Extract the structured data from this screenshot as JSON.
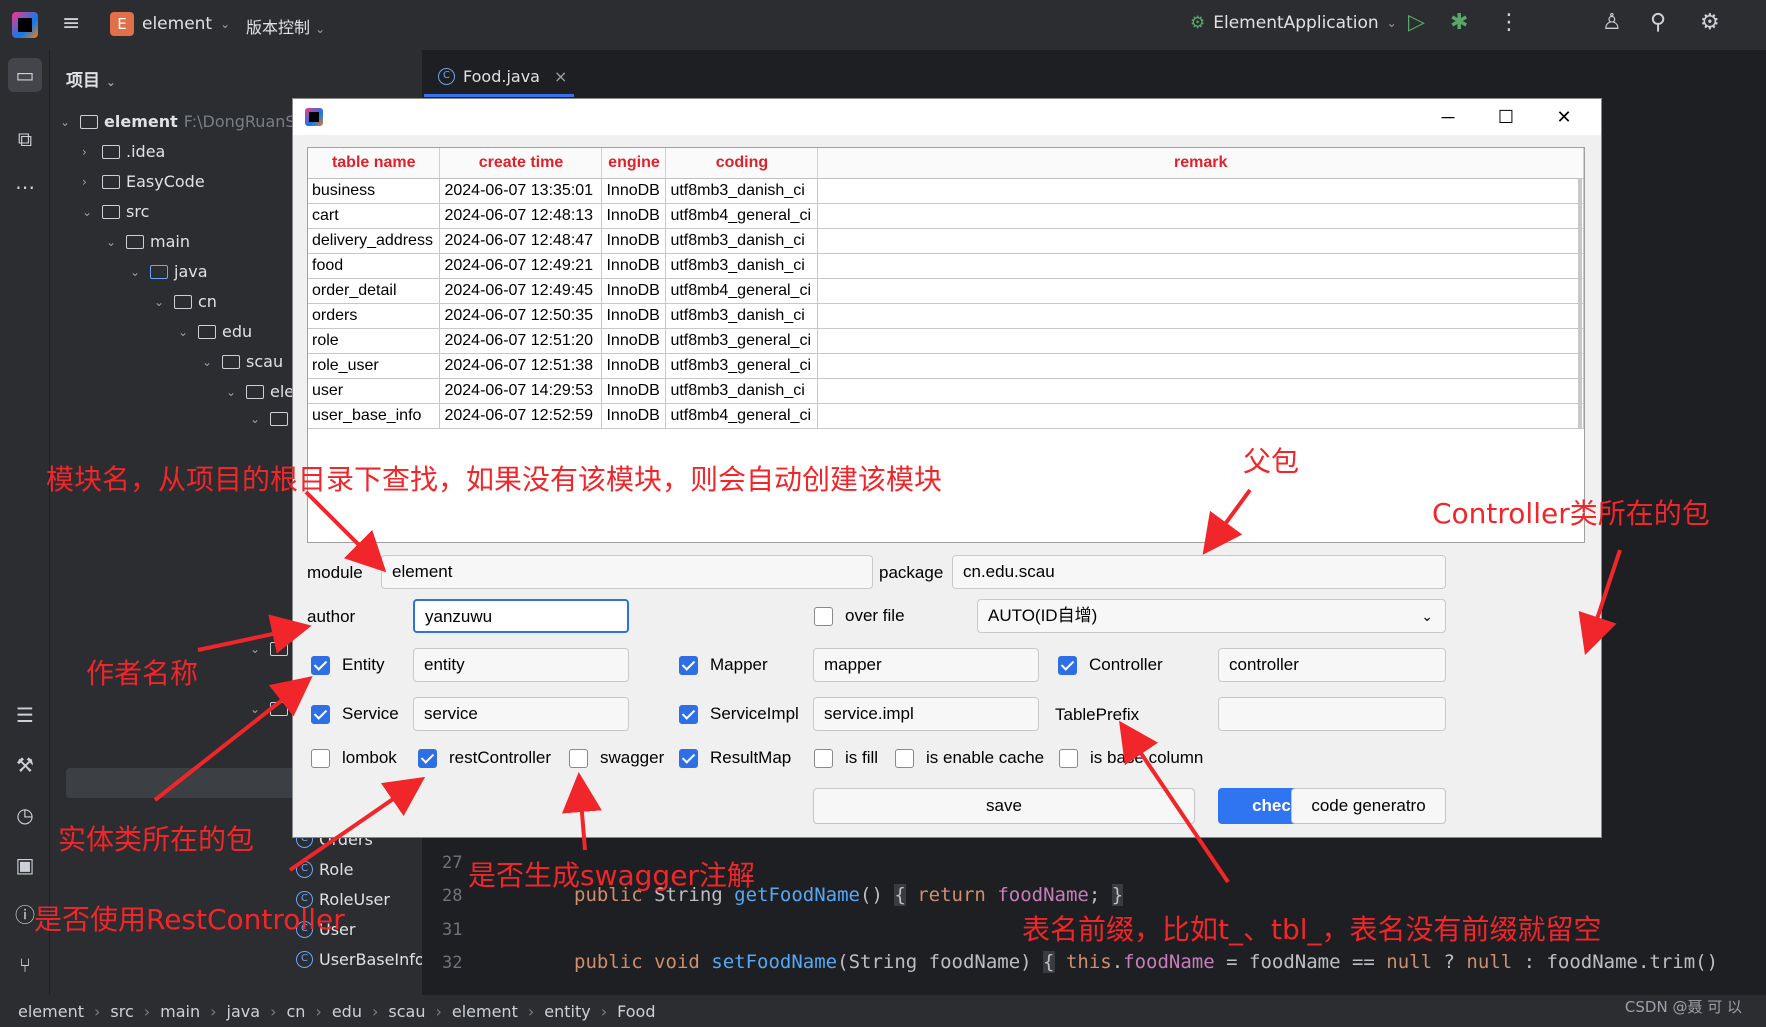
{
  "topbar": {
    "project_badge": "E",
    "project_name": "element",
    "vcs_label": "版本控制",
    "run_config": "ElementApplication"
  },
  "project_panel": {
    "title": "项目",
    "root": {
      "name": "element",
      "path": "F:\\DongRuanS"
    },
    "tree": [
      {
        "label": ".idea"
      },
      {
        "label": "EasyCode"
      },
      {
        "label": "src"
      },
      {
        "label": "main"
      },
      {
        "label": "java"
      },
      {
        "label": "cn"
      },
      {
        "label": "edu"
      },
      {
        "label": "scau"
      },
      {
        "label": "ele"
      }
    ],
    "classes": [
      {
        "label": "Orders"
      },
      {
        "label": "Role"
      },
      {
        "label": "RoleUser"
      },
      {
        "label": "User"
      },
      {
        "label": "UserBaseInfo"
      }
    ]
  },
  "editor": {
    "tab_label": "Food.java",
    "lines": [
      {
        "num": "27",
        "code": ""
      },
      {
        "num": "28",
        "code": "public String getFoodName() { return foodName; }"
      },
      {
        "num": "31",
        "code": ""
      },
      {
        "num": "32",
        "code": "public void setFoodName(String foodName) { this.foodName = foodName == null ? null : foodName.trim()"
      }
    ]
  },
  "dialog": {
    "columns": [
      "table name",
      "create time",
      "engine",
      "coding",
      "remark"
    ],
    "rows": [
      [
        "business",
        "2024-06-07 13:35:01",
        "InnoDB",
        "utf8mb3_danish_ci",
        ""
      ],
      [
        "cart",
        "2024-06-07 12:48:13",
        "InnoDB",
        "utf8mb4_general_ci",
        ""
      ],
      [
        "delivery_address",
        "2024-06-07 12:48:47",
        "InnoDB",
        "utf8mb3_danish_ci",
        ""
      ],
      [
        "food",
        "2024-06-07 12:49:21",
        "InnoDB",
        "utf8mb3_danish_ci",
        ""
      ],
      [
        "order_detail",
        "2024-06-07 12:49:45",
        "InnoDB",
        "utf8mb4_general_ci",
        ""
      ],
      [
        "orders",
        "2024-06-07 12:50:35",
        "InnoDB",
        "utf8mb3_danish_ci",
        ""
      ],
      [
        "role",
        "2024-06-07 12:51:20",
        "InnoDB",
        "utf8mb3_general_ci",
        ""
      ],
      [
        "role_user",
        "2024-06-07 12:51:38",
        "InnoDB",
        "utf8mb3_general_ci",
        ""
      ],
      [
        "user",
        "2024-06-07 14:29:53",
        "InnoDB",
        "utf8mb3_danish_ci",
        ""
      ],
      [
        "user_base_info",
        "2024-06-07 12:52:59",
        "InnoDB",
        "utf8mb4_general_ci",
        ""
      ]
    ],
    "module_label": "module",
    "module_value": "element",
    "package_label": "package",
    "package_value": "cn.edu.scau",
    "author_label": "author",
    "author_value": "yanzuwu",
    "over_file_label": "over file",
    "id_type_value": "AUTO(ID自增)",
    "entity_label": "Entity",
    "entity_value": "entity",
    "mapper_label": "Mapper",
    "mapper_value": "mapper",
    "controller_label": "Controller",
    "controller_value": "controller",
    "service_label": "Service",
    "service_value": "service",
    "serviceimpl_label": "ServiceImpl",
    "serviceimpl_value": "service.impl",
    "tableprefix_label": "TablePrefix",
    "tableprefix_value": "",
    "lombok_label": "lombok",
    "restcontroller_label": "restController",
    "swagger_label": "swagger",
    "resultmap_label": "ResultMap",
    "isfill_label": "is fill",
    "enablecache_label": "is enable cache",
    "basecolumn_label": "is base column",
    "save_label": "save",
    "check_label": "check field",
    "generate_label": "code generatro"
  },
  "annotations": {
    "module": "模块名，从项目的根目录下查找，如果没有该模块，则会自动创建该模块",
    "package": "父包",
    "controller": "Controller类所在的包",
    "author": "作者名称",
    "entity": "实体类所在的包",
    "swagger": "是否生成swagger注解",
    "restcontroller": "是否使用RestController",
    "tableprefix": "表名前缀，比如t_、tbl_，表名没有前缀就留空"
  },
  "statusbar": {
    "crumbs": [
      "element",
      "src",
      "main",
      "java",
      "cn",
      "edu",
      "scau",
      "element",
      "entity",
      "Food"
    ],
    "watermark": "CSDN @聂 可 以"
  },
  "colors": {
    "accent": "#2f74f0",
    "annotation": "#f0262a",
    "header_text": "#e0202a"
  }
}
